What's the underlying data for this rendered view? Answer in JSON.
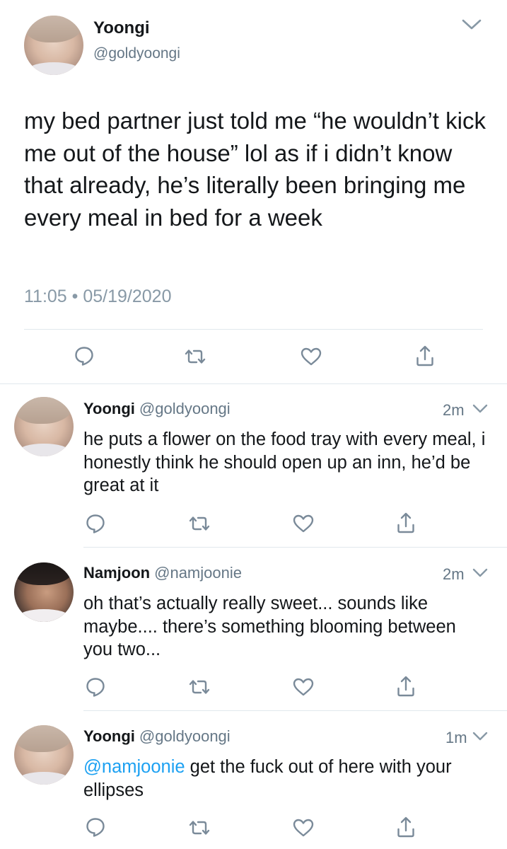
{
  "main_tweet": {
    "display_name": "Yoongi",
    "handle": "@goldyoongi",
    "text": "my bed partner just told me “he wouldn’t kick me out of the house” lol as if i didn’t know that already, he’s literally been bringing me every meal in bed for a week",
    "timestamp": "11:05 • 05/19/2020"
  },
  "replies": [
    {
      "display_name": "Yoongi",
      "handle": "@goldyoongi",
      "time_ago": "2m",
      "text": "he puts a flower on the food tray with every meal, i honestly think he should open up an inn, he’d be great at it"
    },
    {
      "display_name": "Namjoon",
      "handle": "@namjoonie",
      "time_ago": "2m",
      "text": "oh that’s actually really sweet... sounds like maybe.... there’s something blooming between you two..."
    },
    {
      "display_name": "Yoongi",
      "handle": "@goldyoongi",
      "time_ago": "1m",
      "mention": "@namjoonie",
      "text": " get the fuck out of here with your ellipses"
    }
  ],
  "icons": {
    "reply": "speech-bubble-icon",
    "retweet": "retweet-icon",
    "like": "heart-icon",
    "share": "share-icon",
    "more": "chevron-down-icon"
  },
  "colors": {
    "text": "#14171a",
    "secondary": "#657786",
    "timestamp": "#8899a6",
    "icon": "#7a8a99",
    "mention": "#1da1f2",
    "divider": "#e1e8ed"
  }
}
